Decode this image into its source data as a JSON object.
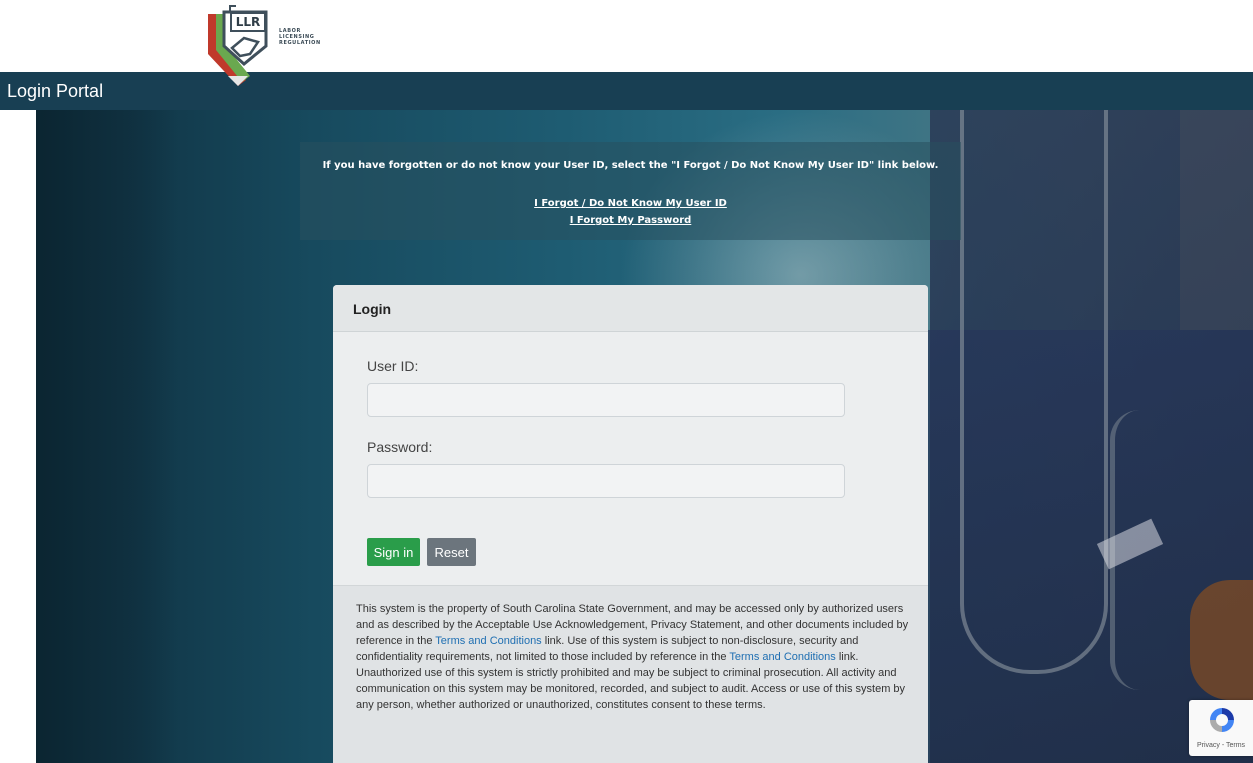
{
  "header": {
    "logo_abbr": "LLR",
    "logo_lines": [
      "LABOR",
      "LICENSING",
      "REGULATION"
    ],
    "portal_title": "Login Portal"
  },
  "notice": {
    "message": "If you have forgotten or do not know your User ID, select the \"I Forgot / Do Not Know My User ID\" link below.",
    "forgot_user_link": "I Forgot / Do Not Know My User ID",
    "forgot_password_link": "I Forgot My Password"
  },
  "login": {
    "title": "Login",
    "user_label": "User ID:",
    "user_value": "",
    "password_label": "Password:",
    "password_value": "",
    "signin_label": "Sign in",
    "reset_label": "Reset"
  },
  "legal": {
    "part1": "This system is the property of South Carolina State Government, and may be accessed only by authorized users and as described by the Acceptable Use Acknowledgement, Privacy Statement, and other documents included by reference in the ",
    "link1": "Terms and Conditions",
    "part2": " link. Use of this system is subject to non-disclosure, security and confidentiality requirements, not limited to those included by reference in the ",
    "link2": "Terms and Conditions",
    "part3": " link. Unauthorized use of this system is strictly prohibited and may be subject to criminal prosecution. All activity and communication on this system may be monitored, recorded, and subject to audit. Access or use of this system by any person, whether authorized or unauthorized, constitutes consent to these terms."
  },
  "recaptcha": {
    "label": "Privacy - Terms"
  },
  "colors": {
    "titlebar": "#183f53",
    "signin": "#2a9d4a",
    "reset": "#6c757d",
    "link": "#1f6fb2"
  }
}
